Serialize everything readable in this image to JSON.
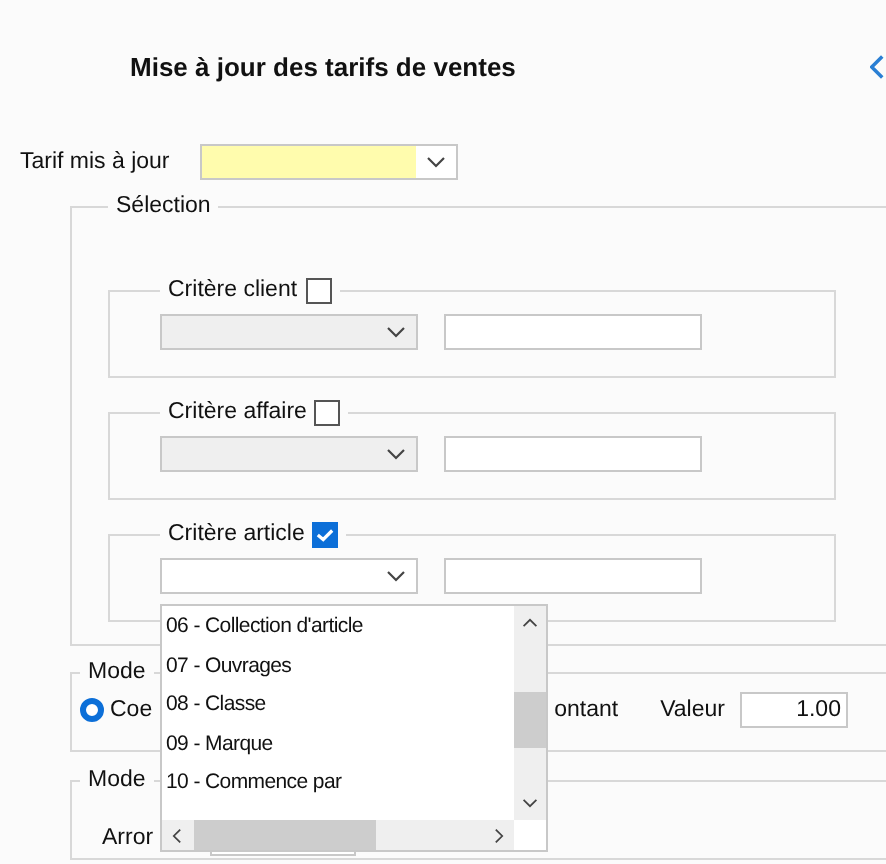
{
  "title": "Mise à jour des tarifs de ventes",
  "tarif": {
    "label": "Tarif mis à jour",
    "required": true
  },
  "selection": {
    "legend": "Sélection",
    "criteria": [
      {
        "label": "Critère client",
        "checked": false
      },
      {
        "label": "Critère affaire",
        "checked": false
      },
      {
        "label": "Critère article",
        "checked": true
      }
    ]
  },
  "dropdown": {
    "items": [
      {
        "label": "06 - Collection d'article"
      },
      {
        "label": "07 - Ouvrages"
      },
      {
        "label": "08 - Classe"
      },
      {
        "label": "09 - Marque"
      },
      {
        "label": "10 - Commence par"
      }
    ]
  },
  "mode_groups": [
    {
      "legend": "Mode",
      "radio": {
        "label": "Coe",
        "selected": true
      },
      "label_2": "ontant",
      "value_label": "Valeur",
      "value": "1.00"
    },
    {
      "legend": "Mode",
      "field_label": "Arror"
    }
  ]
}
